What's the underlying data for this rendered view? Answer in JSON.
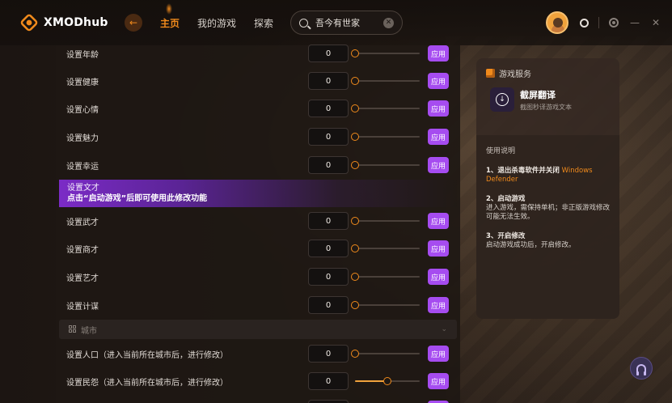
{
  "app": {
    "logo_text": "XMODhub"
  },
  "nav": {
    "back_icon": "arrow-left-icon",
    "items": [
      {
        "label": "主页",
        "active": true
      },
      {
        "label": "我的游戏",
        "active": false
      },
      {
        "label": "探索",
        "active": false
      }
    ]
  },
  "search": {
    "value": "吾今有世家"
  },
  "window": {
    "minimize": "—",
    "close": "✕"
  },
  "colors": {
    "accent": "#f08a1c",
    "apply": "#a64cf0",
    "notice": "#7b2bc6"
  },
  "rows_top": [
    {
      "label": "设置年龄",
      "value": "0",
      "apply": "应用",
      "level": 0
    },
    {
      "label": "设置健康",
      "value": "0",
      "apply": "应用",
      "level": 0
    },
    {
      "label": "设置心情",
      "value": "0",
      "apply": "应用",
      "level": 0
    },
    {
      "label": "设置魅力",
      "value": "0",
      "apply": "应用",
      "level": 0
    },
    {
      "label": "设置幸运",
      "value": "0",
      "apply": "应用",
      "level": 0
    }
  ],
  "notice": {
    "title": "设置文才",
    "text": "点击“启动游戏”后即可使用此修改功能"
  },
  "rows_mid": [
    {
      "label": "设置武才",
      "value": "0",
      "apply": "应用",
      "level": 0
    },
    {
      "label": "设置商才",
      "value": "0",
      "apply": "应用",
      "level": 0
    },
    {
      "label": "设置艺才",
      "value": "0",
      "apply": "应用",
      "level": 0
    },
    {
      "label": "设置计谋",
      "value": "0",
      "apply": "应用",
      "level": 0
    }
  ],
  "section": {
    "label": "城市"
  },
  "rows_city": [
    {
      "label": "设置人口（进入当前所在城市后，进行修改）",
      "value": "0",
      "apply": "应用",
      "level": 0
    },
    {
      "label": "设置民怨（进入当前所在城市后，进行修改）",
      "value": "0",
      "apply": "应用",
      "level": 0.5
    }
  ],
  "service": {
    "title": "游戏服务",
    "app_name": "截屏翻译",
    "app_desc": "截图秒译游戏文本"
  },
  "help": {
    "title": "使用说明",
    "step1_title": "1、退出杀毒软件并关闭",
    "step1_highlight": "Windows Defender",
    "step2_title": "2、启动游戏",
    "step2_text": "进入游戏，需保持单机；非正版游戏修改可能无法生效。",
    "step3_title": "3、开启修改",
    "step3_text": "启动游戏成功后，开启修改。"
  }
}
